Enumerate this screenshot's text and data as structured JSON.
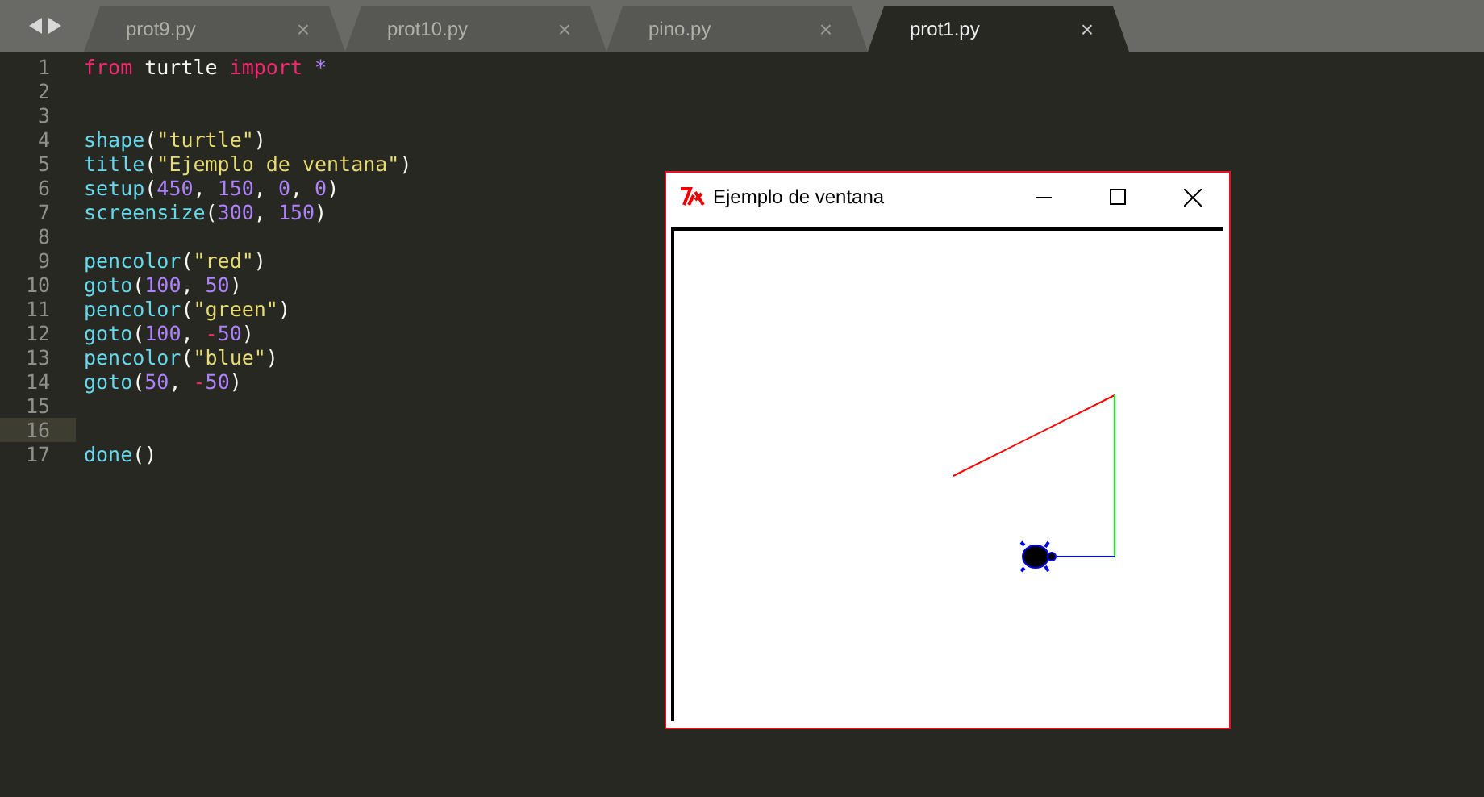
{
  "tabs": [
    {
      "label": "prot9.py",
      "close": "×",
      "selected": false
    },
    {
      "label": "prot10.py",
      "close": "×",
      "selected": false
    },
    {
      "label": "pino.py",
      "close": "×",
      "selected": false
    },
    {
      "label": "prot1.py",
      "close": "×",
      "selected": true
    }
  ],
  "editor": {
    "lines": [
      {
        "number": "1",
        "current": false,
        "tokens": [
          {
            "kind": "keyword",
            "text": "from"
          },
          {
            "kind": "plain",
            "text": " turtle "
          },
          {
            "kind": "keyword",
            "text": "import "
          },
          {
            "kind": "number",
            "text": "*"
          }
        ]
      },
      {
        "number": "2",
        "current": false
      },
      {
        "number": "3",
        "current": false
      },
      {
        "number": "4",
        "current": false,
        "tokens": [
          {
            "kind": "func",
            "text": "shape"
          },
          {
            "kind": "plain",
            "text": "("
          },
          {
            "kind": "string",
            "text": "\"turtle\""
          },
          {
            "kind": "plain",
            "text": ")"
          }
        ]
      },
      {
        "number": "5",
        "current": false,
        "tokens": [
          {
            "kind": "func",
            "text": "title"
          },
          {
            "kind": "plain",
            "text": "("
          },
          {
            "kind": "string",
            "text": "\"Ejemplo de ventana\""
          },
          {
            "kind": "plain",
            "text": ")"
          }
        ]
      },
      {
        "number": "6",
        "current": false,
        "tokens": [
          {
            "kind": "func",
            "text": "setup"
          },
          {
            "kind": "plain",
            "text": "("
          },
          {
            "kind": "number",
            "text": "450"
          },
          {
            "kind": "plain",
            "text": ", "
          },
          {
            "kind": "number",
            "text": "150"
          },
          {
            "kind": "plain",
            "text": ", "
          },
          {
            "kind": "number",
            "text": "0"
          },
          {
            "kind": "plain",
            "text": ", "
          },
          {
            "kind": "number",
            "text": "0"
          },
          {
            "kind": "plain",
            "text": ")"
          }
        ]
      },
      {
        "number": "7",
        "current": false,
        "tokens": [
          {
            "kind": "func",
            "text": "screensize"
          },
          {
            "kind": "plain",
            "text": "("
          },
          {
            "kind": "number",
            "text": "300"
          },
          {
            "kind": "plain",
            "text": ", "
          },
          {
            "kind": "number",
            "text": "150"
          },
          {
            "kind": "plain",
            "text": ")"
          }
        ]
      },
      {
        "number": "8",
        "current": false
      },
      {
        "number": "9",
        "current": false,
        "tokens": [
          {
            "kind": "func",
            "text": "pencolor"
          },
          {
            "kind": "plain",
            "text": "("
          },
          {
            "kind": "string",
            "text": "\"red\""
          },
          {
            "kind": "plain",
            "text": ")"
          }
        ]
      },
      {
        "number": "10",
        "current": false,
        "tokens": [
          {
            "kind": "func",
            "text": "goto"
          },
          {
            "kind": "plain",
            "text": "("
          },
          {
            "kind": "number",
            "text": "100"
          },
          {
            "kind": "plain",
            "text": ", "
          },
          {
            "kind": "number",
            "text": "50"
          },
          {
            "kind": "plain",
            "text": ")"
          }
        ]
      },
      {
        "number": "11",
        "current": false,
        "tokens": [
          {
            "kind": "func",
            "text": "pencolor"
          },
          {
            "kind": "plain",
            "text": "("
          },
          {
            "kind": "string",
            "text": "\"green\""
          },
          {
            "kind": "plain",
            "text": ")"
          }
        ]
      },
      {
        "number": "12",
        "current": false,
        "tokens": [
          {
            "kind": "func",
            "text": "goto"
          },
          {
            "kind": "plain",
            "text": "("
          },
          {
            "kind": "number",
            "text": "100"
          },
          {
            "kind": "plain",
            "text": ", "
          },
          {
            "kind": "keyword",
            "text": "-"
          },
          {
            "kind": "number",
            "text": "50"
          },
          {
            "kind": "plain",
            "text": ")"
          }
        ]
      },
      {
        "number": "13",
        "current": false,
        "tokens": [
          {
            "kind": "func",
            "text": "pencolor"
          },
          {
            "kind": "plain",
            "text": "("
          },
          {
            "kind": "string",
            "text": "\"blue\""
          },
          {
            "kind": "plain",
            "text": ")"
          }
        ]
      },
      {
        "number": "14",
        "current": false,
        "tokens": [
          {
            "kind": "func",
            "text": "goto"
          },
          {
            "kind": "plain",
            "text": "("
          },
          {
            "kind": "number",
            "text": "50"
          },
          {
            "kind": "plain",
            "text": ", "
          },
          {
            "kind": "keyword",
            "text": "-"
          },
          {
            "kind": "number",
            "text": "50"
          },
          {
            "kind": "plain",
            "text": ")"
          }
        ]
      },
      {
        "number": "15",
        "current": false
      },
      {
        "number": "16",
        "current": true
      },
      {
        "number": "17",
        "current": false,
        "tokens": [
          {
            "kind": "func",
            "text": "done"
          },
          {
            "kind": "plain",
            "text": "()"
          }
        ]
      }
    ]
  },
  "turtle_window": {
    "title": "Ejemplo de ventana"
  }
}
